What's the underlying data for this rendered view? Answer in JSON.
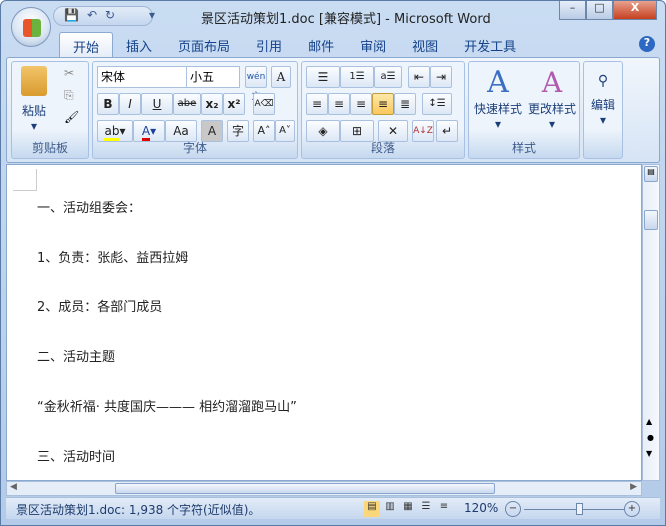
{
  "window": {
    "title": "景区活动策划1.doc [兼容模式] - Microsoft Word",
    "minimize": "–",
    "maximize": "□",
    "close": "X"
  },
  "qat": {
    "save": "💾",
    "undo": "↶",
    "redo": "↻",
    "customize": "▾"
  },
  "tabs": [
    "开始",
    "插入",
    "页面布局",
    "引用",
    "邮件",
    "审阅",
    "视图",
    "开发工具"
  ],
  "help": "?",
  "ribbon": {
    "clipboard": {
      "label": "剪贴板",
      "paste": "粘贴",
      "cut": "✂",
      "copy": "⎘",
      "format_painter": "🖌"
    },
    "font": {
      "label": "字体",
      "font_name": "宋体",
      "font_size": "小五",
      "phonetic": "wén文",
      "char_border": "A",
      "bold": "B",
      "italic": "I",
      "underline": "U",
      "strike": "abe",
      "sub": "x₂",
      "sup": "x²",
      "clear": "A⌫",
      "highlight": "ab",
      "font_color": "A",
      "change_case": "Aa",
      "shading": "A",
      "enclose": "字",
      "grow": "A˄",
      "shrink": "A˅",
      "highlight_color": "#ffff00",
      "font_color_value": "#e00000"
    },
    "paragraph": {
      "label": "段落",
      "bullets": "☰",
      "numbering": "1☰",
      "multilevel": "a☰",
      "dec_indent": "⇤",
      "inc_indent": "⇥",
      "left": "≡",
      "center": "≡",
      "right": "≡",
      "justify": "≡",
      "distributed": "≣",
      "line_spacing": "↕☰",
      "shading": "◈",
      "borders": "⊞",
      "asian": "✕",
      "sort": "A↓Z",
      "show_marks": "↵"
    },
    "styles": {
      "label": "样式",
      "quick": "快速样式",
      "change": "更改样式"
    },
    "editing": {
      "label": "编辑"
    }
  },
  "document": {
    "lines": [
      "一、活动组委会：",
      "1、负责：张彪、益西拉姆",
      "2、成员：各部门成员",
      "二、活动主题",
      "“金秋祈福· 共度国庆———  相约溜溜跑马山”",
      "三、活动时间"
    ]
  },
  "statusbar": {
    "text": "景区活动策划1.doc: 1,938 个字符(近似值)。",
    "zoom": "120%",
    "zoom_out": "−",
    "zoom_in": "+",
    "zoom_level": 0.55
  }
}
